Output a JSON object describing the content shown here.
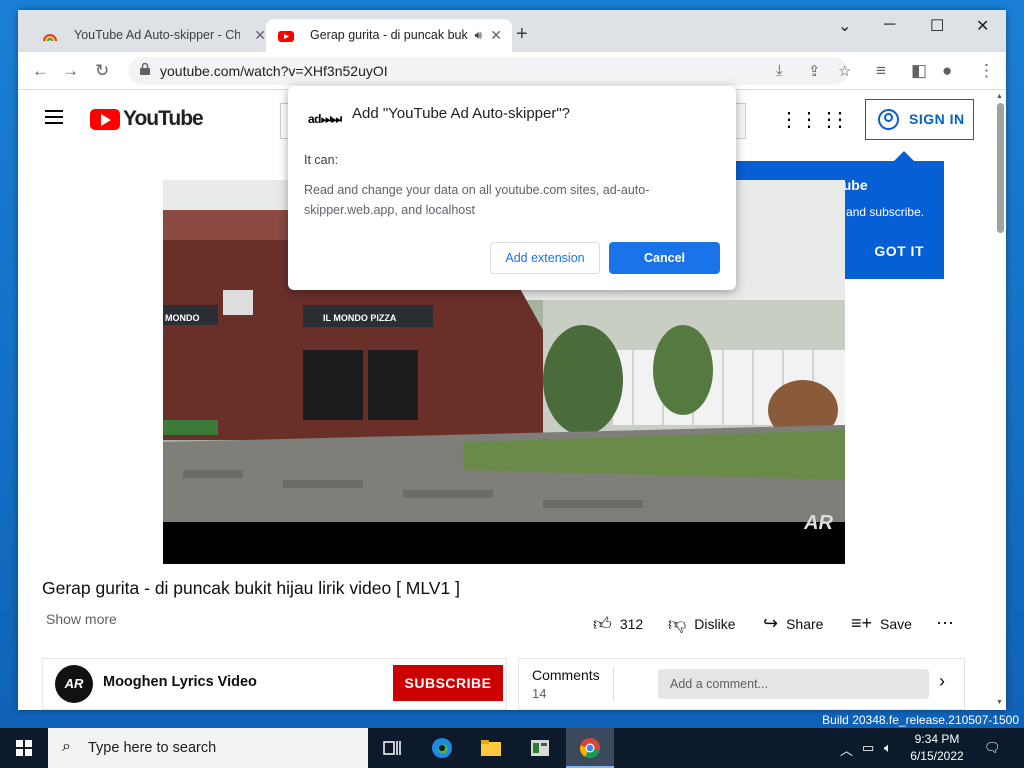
{
  "browser": {
    "tabs": [
      {
        "title": "YouTube Ad Auto-skipper - Chro",
        "active": false
      },
      {
        "title": "Gerap gurita - di puncak buk",
        "active": true
      }
    ],
    "new_tab_symbol": "+",
    "url": "youtube.com/watch?v=XHf3n52uyOI"
  },
  "youtube": {
    "logo_text": "YouTube",
    "sign_in_label": "SIGN IN",
    "popup": {
      "title": "gned out of YouTube",
      "body": "ike videos, comment, and subscribe.",
      "button": "GOT IT"
    },
    "video": {
      "title": "Gerap gurita - di puncak bukit hijau lirik video [ MLV1 ]",
      "show_more": "Show more",
      "likes": "312",
      "dislike_label": "Dislike",
      "share_label": "Share",
      "save_label": "Save",
      "watermark": "AR",
      "scene_signs": [
        "IL MONDO PIZZA",
        "MONDO"
      ]
    },
    "channel": {
      "name": "Mooghen Lyrics Video",
      "avatar_text": "AR",
      "subscribe_label": "SUBSCRIBE"
    },
    "comments": {
      "label": "Comments",
      "count": "14",
      "placeholder": "Add a comment..."
    }
  },
  "dialog": {
    "logo_text": "ad⏭⏭",
    "title": "Add \"YouTube Ad Auto-skipper\"?",
    "it_can": "It can:",
    "permission": "Read and change your data on all youtube.com sites, ad-auto-skipper.web.app, and localhost",
    "add_button": "Add extension",
    "cancel_button": "Cancel"
  },
  "taskbar": {
    "search_placeholder": "Type here to search",
    "time": "9:34 PM",
    "date": "6/15/2022",
    "build": "Build 20348.fe_release.210507-1500"
  },
  "colors": {
    "youtube_red": "#ff0000",
    "subscribe_red": "#cc0000",
    "link_blue": "#065fd4",
    "chrome_blue": "#1a73e8"
  }
}
